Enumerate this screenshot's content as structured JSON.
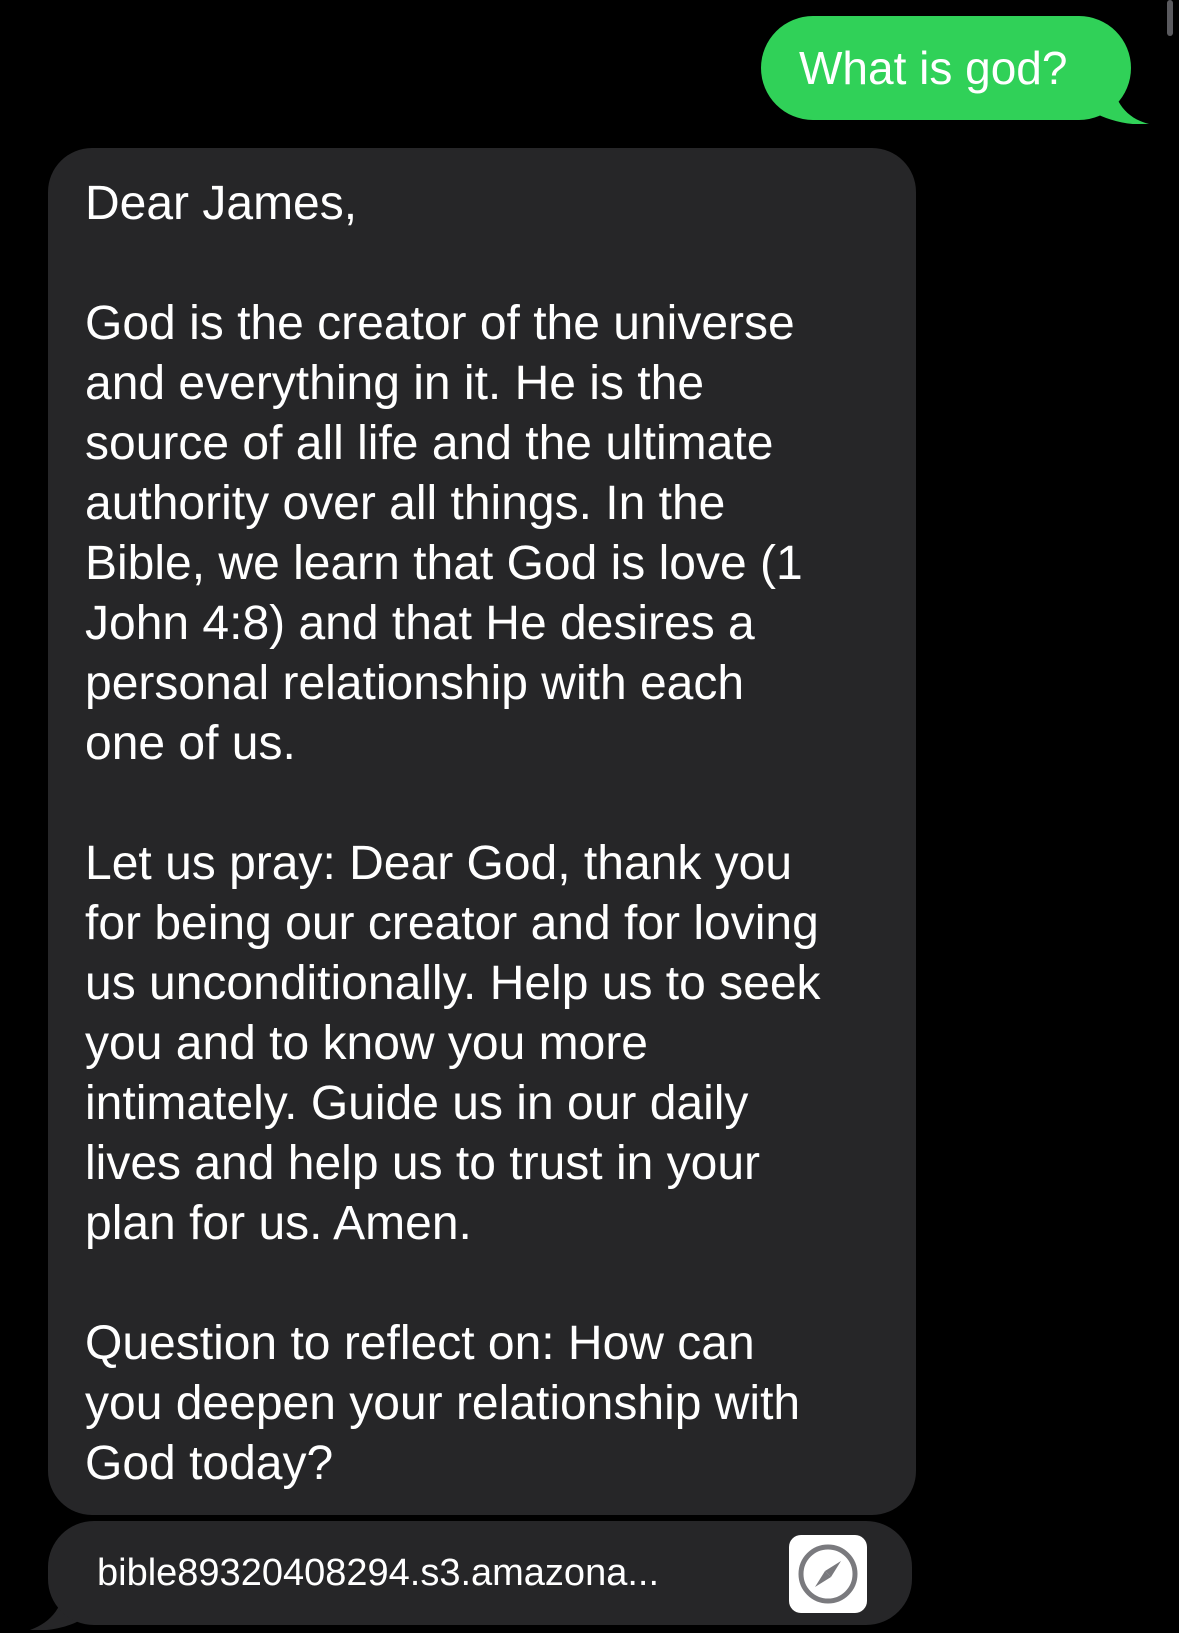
{
  "conversation": {
    "outgoing": {
      "text": "What is god?"
    },
    "incoming": {
      "lines": [
        "Dear James,",
        "",
        "God is the creator of the universe",
        "and everything in it. He is the",
        "source of all life and the ultimate",
        "authority over all things. In the",
        "Bible, we learn that God is love (1",
        "John 4:8) and that He desires a",
        "personal relationship with each",
        "one of us.",
        "",
        "Let us pray: Dear God, thank you",
        "for being our creator and for loving",
        "us unconditionally. Help us to seek",
        "you and to know you more",
        "intimately. Guide us in our daily",
        "lives and help us to trust in your",
        "plan for us. Amen.",
        "",
        "Question to reflect on: How can",
        "you deepen your relationship with",
        "God today?"
      ]
    },
    "link_preview": {
      "text": "bible89320408294.s3.amazona...",
      "icon": "compass-icon"
    }
  },
  "colors": {
    "background": "#000000",
    "outgoing_bubble": "#30d158",
    "incoming_bubble": "#262628",
    "text": "#ffffff"
  }
}
